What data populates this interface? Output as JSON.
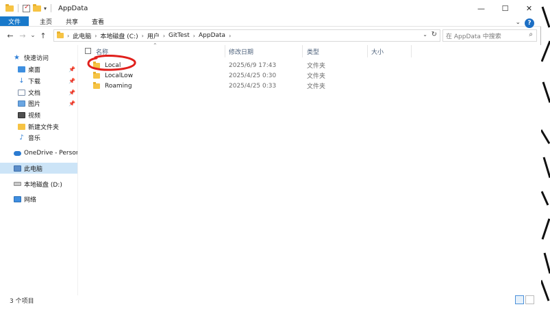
{
  "window": {
    "title": "AppData",
    "controls": {
      "minimize": "—",
      "maximize": "☐",
      "close": "✕"
    }
  },
  "ribbon": {
    "tabs": [
      {
        "label": "文件",
        "active": true
      },
      {
        "label": "主页"
      },
      {
        "label": "共享"
      },
      {
        "label": "查看"
      }
    ],
    "help_label": "?"
  },
  "nav": {
    "back": "←",
    "forward": "→",
    "recent": "⌄",
    "up": "↑",
    "breadcrumb": [
      "此电脑",
      "本地磁盘 (C:)",
      "用户",
      "GitTest",
      "AppData"
    ],
    "search_placeholder": "在 AppData 中搜索"
  },
  "sidebar": {
    "items": [
      {
        "label": "快速访问",
        "icon": "star-icon"
      },
      {
        "label": "桌面",
        "icon": "desktop-icon",
        "pinned": true
      },
      {
        "label": "下载",
        "icon": "download-icon",
        "pinned": true
      },
      {
        "label": "文档",
        "icon": "document-icon",
        "pinned": true
      },
      {
        "label": "图片",
        "icon": "picture-icon",
        "pinned": true
      },
      {
        "label": "视频",
        "icon": "video-icon"
      },
      {
        "label": "新建文件夹",
        "icon": "folder-icon"
      },
      {
        "label": "音乐",
        "icon": "music-icon"
      },
      {
        "label": "OneDrive - Personal",
        "icon": "onedrive-icon"
      },
      {
        "label": "此电脑",
        "icon": "this-pc-icon",
        "selected": true
      },
      {
        "label": "本地磁盘 (D:)",
        "icon": "drive-icon"
      },
      {
        "label": "网络",
        "icon": "network-icon"
      }
    ]
  },
  "columns": {
    "name": "名称",
    "modified": "修改日期",
    "type": "类型",
    "size": "大小"
  },
  "files": [
    {
      "name": "Local",
      "modified": "2025/6/9 17:43",
      "type": "文件夹",
      "size": ""
    },
    {
      "name": "LocalLow",
      "modified": "2025/4/25 0:30",
      "type": "文件夹",
      "size": ""
    },
    {
      "name": "Roaming",
      "modified": "2025/4/25 0:33",
      "type": "文件夹",
      "size": ""
    }
  ],
  "status": {
    "item_count": "3 个项目"
  },
  "colors": {
    "accent": "#1979ca",
    "selection": "#cce4f7",
    "annotation": "#e0201c",
    "folder": "#f6c344"
  }
}
